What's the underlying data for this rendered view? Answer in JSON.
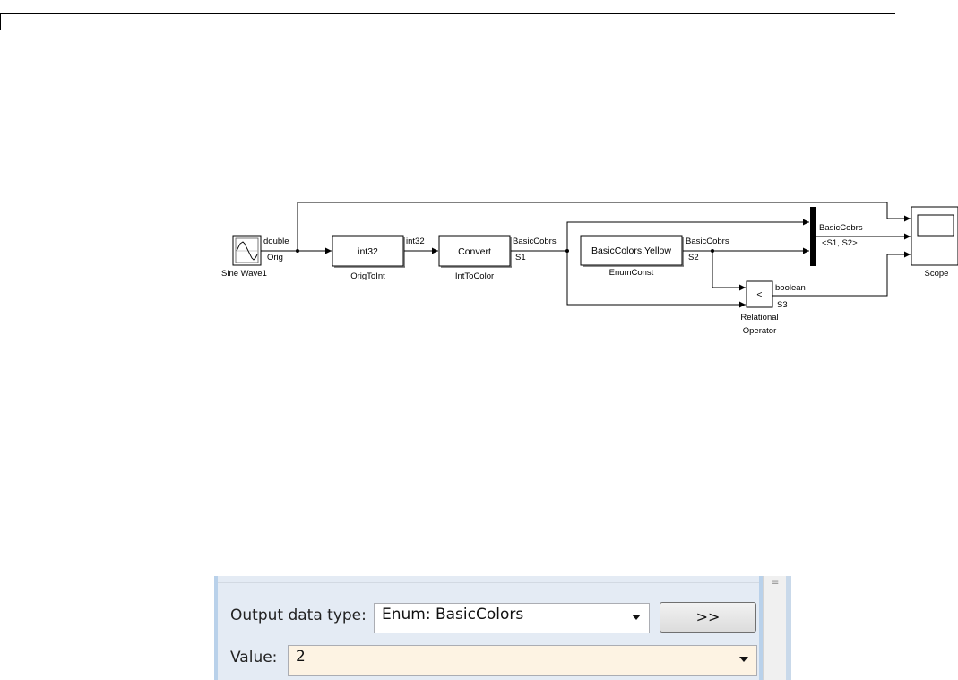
{
  "diagram": {
    "blocks": {
      "sine_wave": {
        "name": "Sine Wave1"
      },
      "orig_to_int": {
        "label": "int32",
        "name": "OrigToInt"
      },
      "int_to_color": {
        "label": "Convert",
        "name": "IntToColor"
      },
      "enum_const": {
        "label": "BasicColors.Yellow",
        "name": "EnumConst"
      },
      "relational": {
        "label": "<",
        "name_line1": "Relational",
        "name_line2": "Operator"
      },
      "scope": {
        "name": "Scope"
      }
    },
    "signals": {
      "sine_type": "double",
      "sine_name": "Orig",
      "int_type": "int32",
      "convert_type": "BasicCobrs",
      "convert_name": "S1",
      "enum_type": "BasicCobrs",
      "enum_name": "S2",
      "mux_type": "BasicCobrs",
      "mux_name": "<S1, S2>",
      "rel_type": "boolean",
      "rel_name": "S3"
    }
  },
  "dialog": {
    "output_type_label": "Output data type:",
    "output_type_value": "Enum: BasicColors",
    "more_button": ">>",
    "value_label": "Value:",
    "value_value": "2"
  }
}
